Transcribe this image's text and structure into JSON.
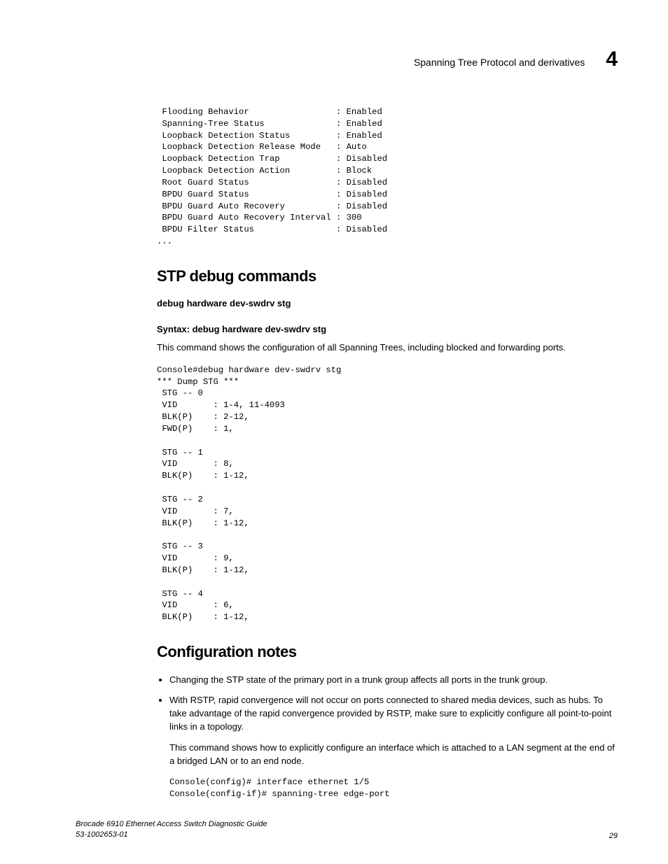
{
  "header": {
    "title": "Spanning Tree Protocol and derivatives",
    "chapter_num": "4"
  },
  "code_block_top": " Flooding Behavior                 : Enabled\n Spanning-Tree Status              : Enabled\n Loopback Detection Status         : Enabled\n Loopback Detection Release Mode   : Auto\n Loopback Detection Trap           : Disabled\n Loopback Detection Action         : Block\n Root Guard Status                 : Disabled\n BPDU Guard Status                 : Disabled\n BPDU Guard Auto Recovery          : Disabled\n BPDU Guard Auto Recovery Interval : 300\n BPDU Filter Status                : Disabled\n...",
  "section_stp": {
    "heading": "STP debug commands",
    "sub": "debug hardware dev-swdrv stg",
    "syntax_line": "Syntax:   debug hardware dev-swdrv stg",
    "desc": "This command shows the configuration of all Spanning Trees, including blocked and forwarding ports.",
    "code": "Console#debug hardware dev-swdrv stg\n*** Dump STG ***\n STG -- 0\n VID       : 1-4, 11-4093\n BLK(P)    : 2-12,\n FWD(P)    : 1,\n\n STG -- 1\n VID       : 8,\n BLK(P)    : 1-12,\n\n STG -- 2\n VID       : 7,\n BLK(P)    : 1-12,\n\n STG -- 3\n VID       : 9,\n BLK(P)    : 1-12,\n\n STG -- 4\n VID       : 6,\n BLK(P)    : 1-12,"
  },
  "section_conf": {
    "heading": "Configuration notes",
    "bullets": [
      "Changing the STP state of the primary port in a trunk group affects all ports in the trunk group.",
      "With RSTP, rapid convergence will not occur on ports connected to shared media devices, such as hubs. To take advantage of the rapid convergence provided by RSTP, make sure to explicitly configure all point-to-point links in a topology."
    ],
    "second_bullet_sub": "This command shows how to explicitly configure an interface which is attached to a LAN segment at the end of a bridged LAN or to an end node.",
    "second_bullet_code": "Console(config)# interface ethernet 1/5\nConsole(config-if)# spanning-tree edge-port"
  },
  "footer": {
    "left_line1": "Brocade 6910 Ethernet Access Switch Diagnostic Guide",
    "left_line2": "53-1002653-01",
    "page_num": "29"
  }
}
